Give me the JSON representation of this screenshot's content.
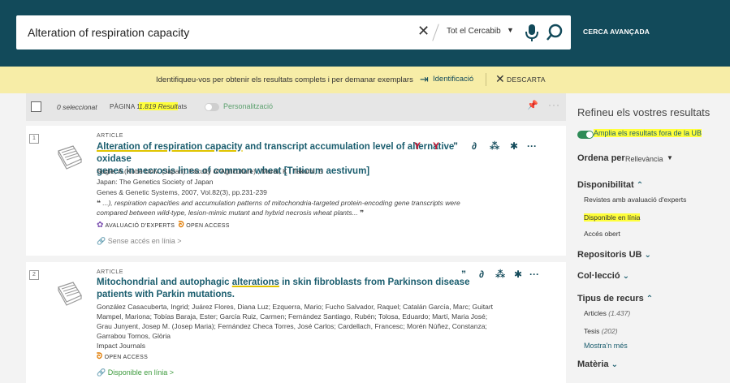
{
  "search": {
    "query": "Alteration of respiration capacity",
    "scope": "Tot el Cercabib",
    "advanced_label": "CERCA AVANÇADA"
  },
  "banner": {
    "message": "Identifiqueu-vos per obtenir els resultats complets i per demanar exemplars",
    "login_label": "Identificació",
    "dismiss_label": "DESCARTA"
  },
  "toolbar": {
    "selected_label": "0 seleccionat",
    "page_label": "PÀGINA 1",
    "results_count": "1.819 Result",
    "results_suffix": "ats",
    "personalize_label": "Personalització"
  },
  "results": [
    {
      "number": "1",
      "type": "ARTICLE",
      "title_highlight": "Alteration of respiration capacity",
      "title_rest_line1": " and transcript accumulation level of alternative oxidase",
      "title_line2": "genes in necrosis lines of common wheat [Triticum aestivum]",
      "authors": "Sugie, A.(Kobe Univ. (Japan). Faculty of Agriculture) ; Murai, K ; Takumi, S",
      "publisher": "Japan: The Genetics Society of Japan",
      "source": "Genes & Genetic Systems, 2007, Vol.82(3), pp.231-239",
      "snippet_line1": "...), respiration capacities and accumulation patterns of mitochondria-targeted protein-encoding gene transcripts were",
      "snippet_line2": "compared between wild-type, lesion-mimic mutant and hybrid necrosis wheat plants...",
      "badge_peer": "AVALUACIÓ D'EXPERTS",
      "badge_open": "OPEN ACCESS",
      "availability": "Sense accés en línia"
    },
    {
      "number": "2",
      "type": "ARTICLE",
      "title_pre": "Mitochondrial and autophagic ",
      "title_highlight": "alterations",
      "title_rest_line1": " in skin fibroblasts from Parkinson disease",
      "title_line2": "patients with Parkin mutations.",
      "authors_line1": "González Casacuberta, Ingrid; Juárez Flores, Diana Luz; Ezquerra, Mario; Fucho Salvador, Raquel; Catalán García, Marc; Guitart",
      "authors_line2": "Mampel, Mariona; Tobías Baraja, Ester; García Ruiz, Carmen; Fernández Santiago, Rubén; Tolosa, Eduardo; Martí, Maria José;",
      "authors_line3": "Grau Junyent, Josep M. (Josep Maria); Fernández Checa Torres, José Carlos; Cardellach, Francesc; Morén Núñez, Constanza;",
      "authors_line4": "Garrabou Tornos, Glòria",
      "publisher": "Impact Journals",
      "badge_open": "OPEN ACCESS",
      "availability": "Disponible en línia"
    }
  ],
  "sidebar": {
    "title": "Refineu els vostres resultats",
    "expand_label": "Amplia els resultats fora de la UB",
    "sort_label": "Ordena per",
    "sort_value": "Rellevància",
    "availability_head": "Disponibilitat",
    "availability_items": [
      "Revistes amb avaluació d'experts",
      "Disponible en línia",
      "Accés obert"
    ],
    "repos_head": "Repositoris UB",
    "collection_head": "Col·lecció",
    "resource_head": "Tipus de recurs",
    "resource_items": [
      {
        "label": "Articles",
        "count": "(1.437)"
      },
      {
        "label": "Tesis",
        "count": "(202)"
      }
    ],
    "show_more": "Mostra'n més",
    "subject_head": "Matèria"
  },
  "colors": {
    "header_bg": "#124a5a",
    "banner_bg": "#f7eda7",
    "link": "#1a5d6e",
    "highlight": "#ffff3b",
    "open_access": "#e07a00"
  }
}
